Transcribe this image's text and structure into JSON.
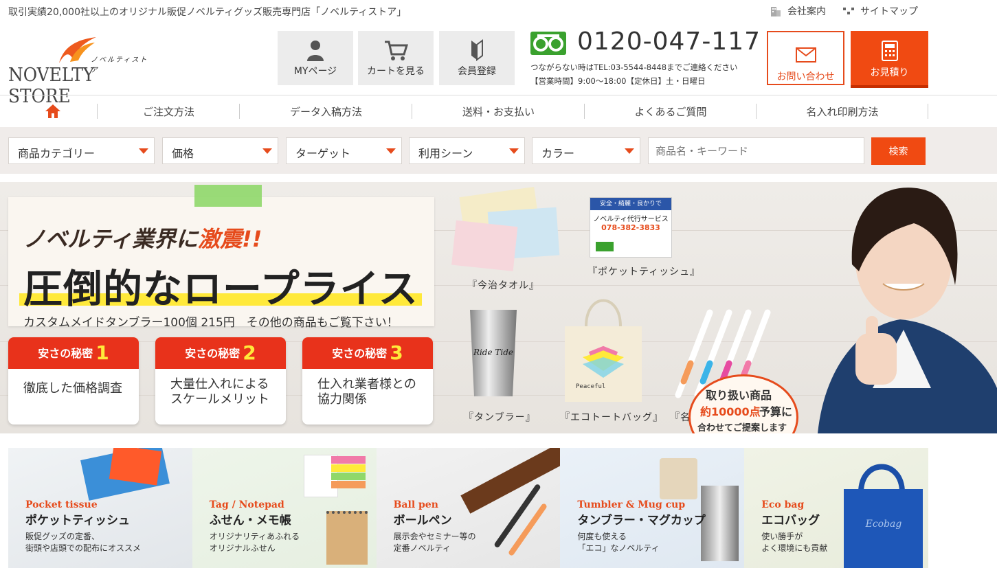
{
  "header": {
    "tagline": "取引実績20,000社以上のオリジナル販促ノベルティグッズ販売専門店「ノベルティストア」",
    "company_link": "会社案内",
    "sitemap_link": "サイトマップ"
  },
  "logo": {
    "kana": "ノベルティストア",
    "word": "NOVELTY STORE"
  },
  "actions": {
    "mypage": "MYページ",
    "cart": "カートを見る",
    "register": "会員登録"
  },
  "phone": {
    "number": "0120-047-117",
    "alt": "つながらない時はTEL:03-5544-8448までご連絡ください",
    "hours": "【営業時間】9:00～18:00【定休日】土・日曜日"
  },
  "cta": {
    "contact": "お問い合わせ",
    "estimate": "お見積り"
  },
  "nav": {
    "home": "home",
    "items": [
      "ご注文方法",
      "データ入稿方法",
      "送料・お支払い",
      "よくあるご質問",
      "名入れ印刷方法"
    ]
  },
  "search": {
    "category": "商品カテゴリー",
    "price": "価格",
    "target": "ターゲット",
    "scene": "利用シーン",
    "color": "カラー",
    "placeholder": "商品名・キーワード",
    "button": "検索"
  },
  "hero": {
    "headline_a": "ノベルティ業界",
    "headline_b": "に",
    "headline_c": "激震!!",
    "main": "圧倒的なロープライス",
    "sub": "カスタムメイドタンブラー100個 215円　その他の商品もご覧下さい！",
    "secrets": [
      {
        "label": "安さの秘密",
        "num": "1",
        "line1": "徹底した価格調査",
        "line2": ""
      },
      {
        "label": "安さの秘密",
        "num": "2",
        "line1": "大量仕入れによる",
        "line2": "スケールメリット"
      },
      {
        "label": "安さの秘密",
        "num": "3",
        "line1": "仕入れ業者様との",
        "line2": "協力関係"
      }
    ],
    "products": [
      "『今治タオル』",
      "『ポケットティッシュ』",
      "『タンブラー』",
      "『エコトートバッグ』",
      "『名入れボールペン』"
    ],
    "bubble": [
      "取り扱い商品",
      "約10000点",
      "予算に",
      "合わせてご提案します"
    ],
    "tissue_text": "ノベルティ代行サービス",
    "tissue_phone": "078-382-3833",
    "tissue_top": "安全・綺麗・良かりで",
    "tumbler_text": "Ride Tide",
    "bag_text": "Peaceful"
  },
  "categories": [
    {
      "en": "Pocket tissue",
      "jp": "ポケットティッシュ",
      "d1": "販促グッズの定番、",
      "d2": "街頭や店頭での配布にオススメ"
    },
    {
      "en": "Tag / Notepad",
      "jp": "ふせん・メモ帳",
      "d1": "オリジナリティあふれる",
      "d2": "オリジナルふせん"
    },
    {
      "en": "Ball pen",
      "jp": "ボールペン",
      "d1": "展示会やセミナー等の",
      "d2": "定番ノベルティ"
    },
    {
      "en": "Tumbler & Mug cup",
      "jp": "タンブラー・マグカップ",
      "d1": "何度も使える",
      "d2": "「エコ」なノベルティ"
    },
    {
      "en": "Eco bag",
      "jp": "エコバッグ",
      "d1": "使い勝手が",
      "d2": "よく環境にも貢献",
      "bag_text": "Ecobag"
    }
  ],
  "colors": {
    "accent": "#f04a12",
    "red": "#e8321b",
    "yellow": "#ffe93a",
    "green": "#3aa12e"
  }
}
